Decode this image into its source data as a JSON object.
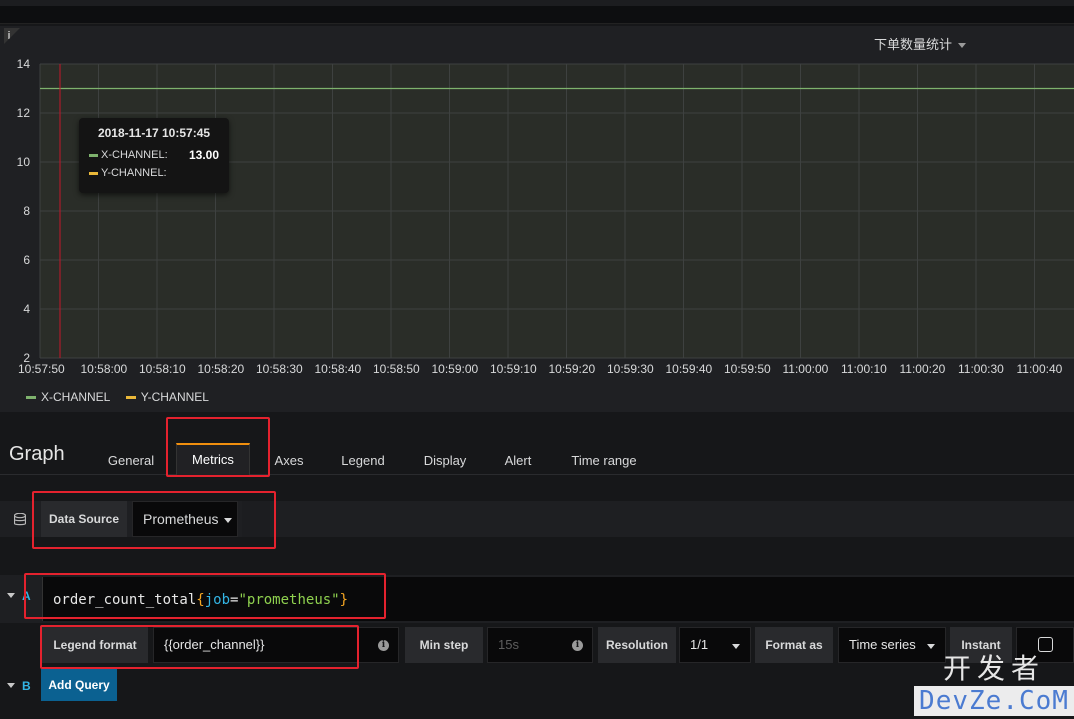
{
  "panel": {
    "title": "下单数量统计",
    "info_glyph": "i"
  },
  "chart_data": {
    "type": "line",
    "x": [
      "10:57:50",
      "10:58:00",
      "10:58:10",
      "10:58:20",
      "10:58:30",
      "10:58:40",
      "10:58:50",
      "10:59:00",
      "10:59:10",
      "10:59:20",
      "10:59:30",
      "10:59:40",
      "10:59:50",
      "11:00:00",
      "11:00:10",
      "11:00:20",
      "11:00:30",
      "11:00:40"
    ],
    "y_ticks": [
      2,
      4,
      6,
      8,
      10,
      12,
      14
    ],
    "ylim": [
      2,
      14
    ],
    "series": [
      {
        "name": "X-CHANNEL",
        "color": "#7eb26d",
        "values": [
          13,
          13,
          13,
          13,
          13,
          13,
          13,
          13,
          13,
          13,
          13,
          13,
          13,
          13,
          13,
          13,
          13,
          13,
          13
        ]
      },
      {
        "name": "Y-CHANNEL",
        "color": "#eab839",
        "values": []
      }
    ],
    "grid": true,
    "legend": "bottom-left",
    "cursor_x": "10:57:50"
  },
  "tooltip": {
    "time": "2018-11-17 10:57:45",
    "rows": [
      {
        "name": "X-CHANNEL:",
        "value": "13.00",
        "color": "#7eb26d"
      },
      {
        "name": "Y-CHANNEL:",
        "value": "",
        "color": "#eab839"
      }
    ]
  },
  "editor": {
    "title": "Graph",
    "tabs": [
      "General",
      "Metrics",
      "Axes",
      "Legend",
      "Display",
      "Alert",
      "Time range"
    ],
    "active_tab": "Metrics"
  },
  "datasource": {
    "label": "Data Source",
    "value": "Prometheus"
  },
  "queries": [
    {
      "letter": "A",
      "metric": "order_count_total",
      "open_brace": "{",
      "label_key": "job",
      "equals": "=",
      "label_value": "\"prometheus\"",
      "close_brace": "}",
      "legend_format_label": "Legend format",
      "legend_format_value": "{{order_channel}}",
      "min_step_label": "Min step",
      "min_step_placeholder": "15s",
      "resolution_label": "Resolution",
      "resolution_value": "1/1",
      "format_as_label": "Format as",
      "format_as_value": "Time series",
      "instant_label": "Instant",
      "instant_checked": false
    },
    {
      "letter": "B"
    }
  ],
  "add_query_label": "Add Query",
  "watermark": {
    "line1": "开发者",
    "line2": "DevZe.CoM"
  },
  "colors": {
    "highlight_box": "#e4222e",
    "active_tab_accent": "#f18f0e",
    "add_query_bg": "#0b6191"
  }
}
